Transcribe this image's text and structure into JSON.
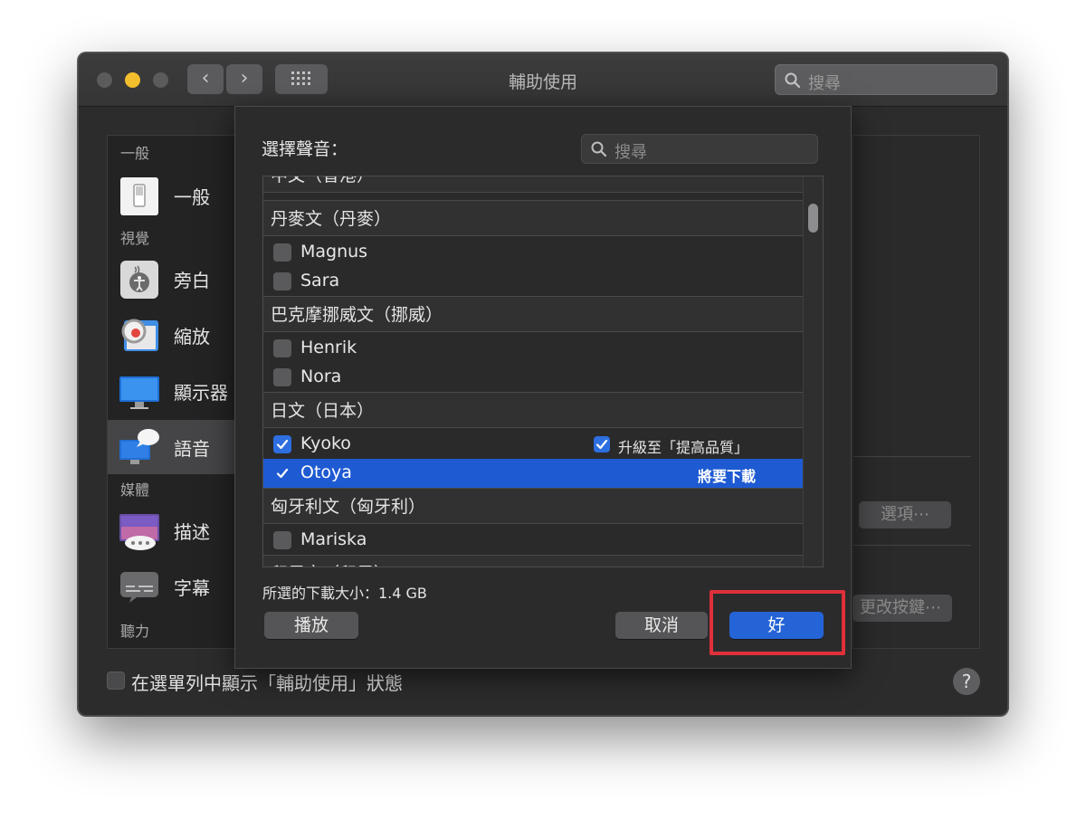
{
  "window": {
    "title": "輔助使用",
    "search_placeholder": "搜尋"
  },
  "sidebar": {
    "sections": [
      {
        "label": "一般"
      },
      {
        "label": "視覺"
      },
      {
        "label": "媒體"
      },
      {
        "label": "聽力"
      }
    ],
    "items": [
      {
        "label": "一般",
        "icon": "switch-icon"
      },
      {
        "label": "旁白",
        "icon": "voiceover-icon"
      },
      {
        "label": "縮放",
        "icon": "zoom-icon"
      },
      {
        "label": "顯示器",
        "icon": "display-icon"
      },
      {
        "label": "語音",
        "icon": "speech-icon",
        "selected": true
      },
      {
        "label": "描述",
        "icon": "descriptions-icon"
      },
      {
        "label": "字幕",
        "icon": "captions-icon"
      }
    ]
  },
  "right_panel": {
    "options_button": "選項⋯",
    "change_key_button": "更改按鍵⋯"
  },
  "bottom": {
    "menu_bar_label": "在選單列中顯示「輔助使用」狀態",
    "help": "?"
  },
  "sheet": {
    "title": "選擇聲音：",
    "search_placeholder": "搜尋",
    "groups": [
      {
        "label": "中文（香港）"
      },
      {
        "label": "丹麥文（丹麥）"
      },
      {
        "label": "巴克摩挪威文（挪威）"
      },
      {
        "label": "日文（日本）"
      },
      {
        "label": "匈牙利文（匈牙利）"
      },
      {
        "label": "印尼文（印尼）"
      }
    ],
    "voices": [
      {
        "name": "Magnus",
        "checked": false
      },
      {
        "name": "Sara",
        "checked": false
      },
      {
        "name": "Henrik",
        "checked": false
      },
      {
        "name": "Nora",
        "checked": false
      },
      {
        "name": "Kyoko",
        "checked": true,
        "extra": "升級至「提高品質」"
      },
      {
        "name": "Otoya",
        "checked": true,
        "selected": true,
        "extra": "將要下載"
      },
      {
        "name": "Mariska",
        "checked": false
      }
    ],
    "download_size": "所選的下載大小：1.4 GB",
    "play_button": "播放",
    "cancel_button": "取消",
    "ok_button": "好"
  },
  "colors": {
    "accent": "#2464d6",
    "selection": "#1e5ad2",
    "highlight_border": "#e0303a",
    "window_bg": "#2c2c2d"
  }
}
